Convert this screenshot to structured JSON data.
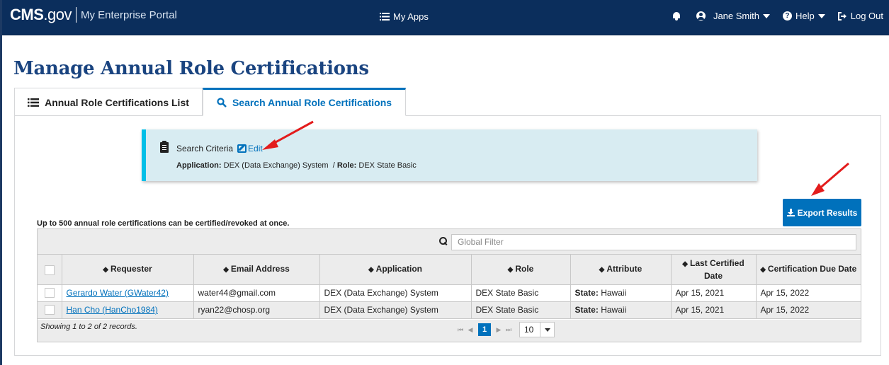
{
  "header": {
    "logo": "CMS",
    "logo_suffix": ".gov",
    "portal_name": "My Enterprise Portal",
    "my_apps": "My Apps",
    "user_name": "Jane Smith",
    "help": "Help",
    "logout": "Log Out"
  },
  "page": {
    "title": "Manage Annual Role Certifications"
  },
  "tabs": [
    {
      "label": "Annual Role Certifications List",
      "icon": "list-icon",
      "active": false
    },
    {
      "label": "Search Annual Role Certifications",
      "icon": "search-icon",
      "active": true
    }
  ],
  "criteria": {
    "heading": "Search Criteria",
    "edit_label": "Edit",
    "application_label": "Application:",
    "application_value": "DEX (Data Exchange) System",
    "separator": "/",
    "role_label": "Role:",
    "role_value": "DEX State Basic"
  },
  "export": {
    "label": "Export Results"
  },
  "note": "Up to 500 annual role certifications can be certified/revoked at once.",
  "filter": {
    "placeholder": "Global Filter"
  },
  "table": {
    "columns": [
      "Requester",
      "Email Address",
      "Application",
      "Role",
      "Attribute",
      "Last Certified Date",
      "Certification Due Date"
    ],
    "rows": [
      {
        "requester": "Gerardo Water (GWater42)",
        "email": "water44@gmail.com",
        "application": "DEX (Data Exchange) System",
        "role": "DEX State Basic",
        "attribute_label": "State:",
        "attribute_value": "Hawaii",
        "last_certified": "Apr 15, 2021",
        "due": "Apr 15, 2022"
      },
      {
        "requester": "Han Cho (HanCho1984)",
        "email": "ryan22@chosp.org",
        "application": "DEX (Data Exchange) System",
        "role": "DEX State Basic",
        "attribute_label": "State:",
        "attribute_value": "Hawaii",
        "last_certified": "Apr 15, 2021",
        "due": "Apr 15, 2022"
      }
    ]
  },
  "footer": {
    "records": "Showing 1 to 2 of 2 records.",
    "current_page": "1",
    "page_size": "10"
  },
  "colors": {
    "nav": "#0b2e5c",
    "title": "#1a4480",
    "primary": "#0071bc",
    "criteria_bg": "#d8ecf2",
    "criteria_accent": "#02bfe7",
    "annotation_arrow": "#e31c1c"
  }
}
